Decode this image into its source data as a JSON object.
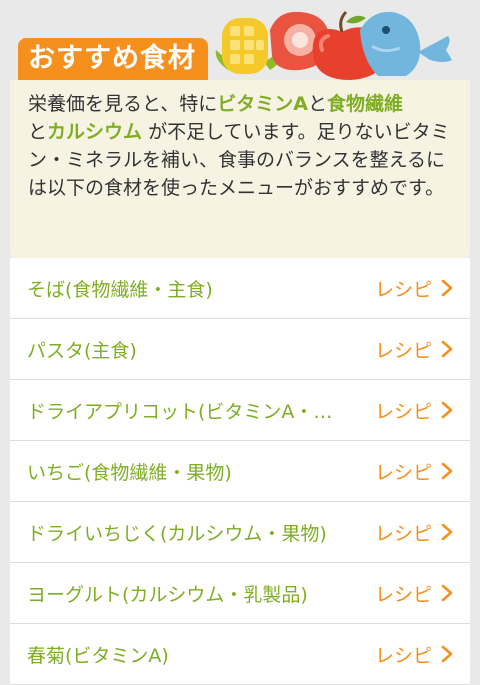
{
  "header": {
    "title": "おすすめ食材"
  },
  "intro": {
    "p1": "栄養価を見ると、特に",
    "hl1": "ビタミンA",
    "p2": "と",
    "hl2": "食物繊維",
    "p3": "と",
    "hl3": "カルシウム",
    "p4": " が不足しています。足りないビタミン・ミネラルを補い、食事のバランスを整えるには以下の食材を使ったメニューがおすすめです。"
  },
  "recipe_label": "レシピ",
  "items": [
    {
      "name": "そば(食物繊維・主食)"
    },
    {
      "name": "パスタ(主食)"
    },
    {
      "name": "ドライアプリコット(ビタミンA・…"
    },
    {
      "name": "いちご(食物繊維・果物)"
    },
    {
      "name": "ドライいちじく(カルシウム・果物)"
    },
    {
      "name": "ヨーグルト(カルシウム・乳製品)"
    },
    {
      "name": "春菊(ビタミンA)"
    }
  ],
  "colors": {
    "accent_orange": "#f5901f",
    "accent_green": "#7fae25",
    "intro_bg": "#f7f3e3"
  },
  "icons": [
    "corn-icon",
    "meat-icon",
    "apple-icon",
    "fish-icon",
    "chevron-right-icon"
  ]
}
